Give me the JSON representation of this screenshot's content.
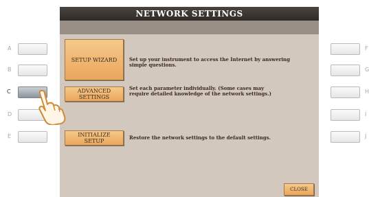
{
  "title": "NETWORK SETTINGS",
  "options": [
    {
      "label": "SETUP WIZARD",
      "description": "Set up your instrument to access the Internet by answering simple questions."
    },
    {
      "label": "ADVANCED SETTINGS",
      "description": "Set each parameter individually. (Some cases may require detailed knowledge of the network settings.)"
    },
    {
      "label": "INITIALIZE SETUP",
      "description": "Restore the network settings to the default settings."
    }
  ],
  "close_label": "CLOSE",
  "left_buttons": [
    "A",
    "B",
    "C",
    "D",
    "E"
  ],
  "right_buttons": [
    "F",
    "G",
    "H",
    "I",
    "J"
  ],
  "active_button": "C",
  "colors": {
    "screen": "#d3c8bd",
    "button": "#f0b876",
    "title": "#3a3431"
  },
  "icons": {
    "pointer": "pointing-hand-icon"
  }
}
